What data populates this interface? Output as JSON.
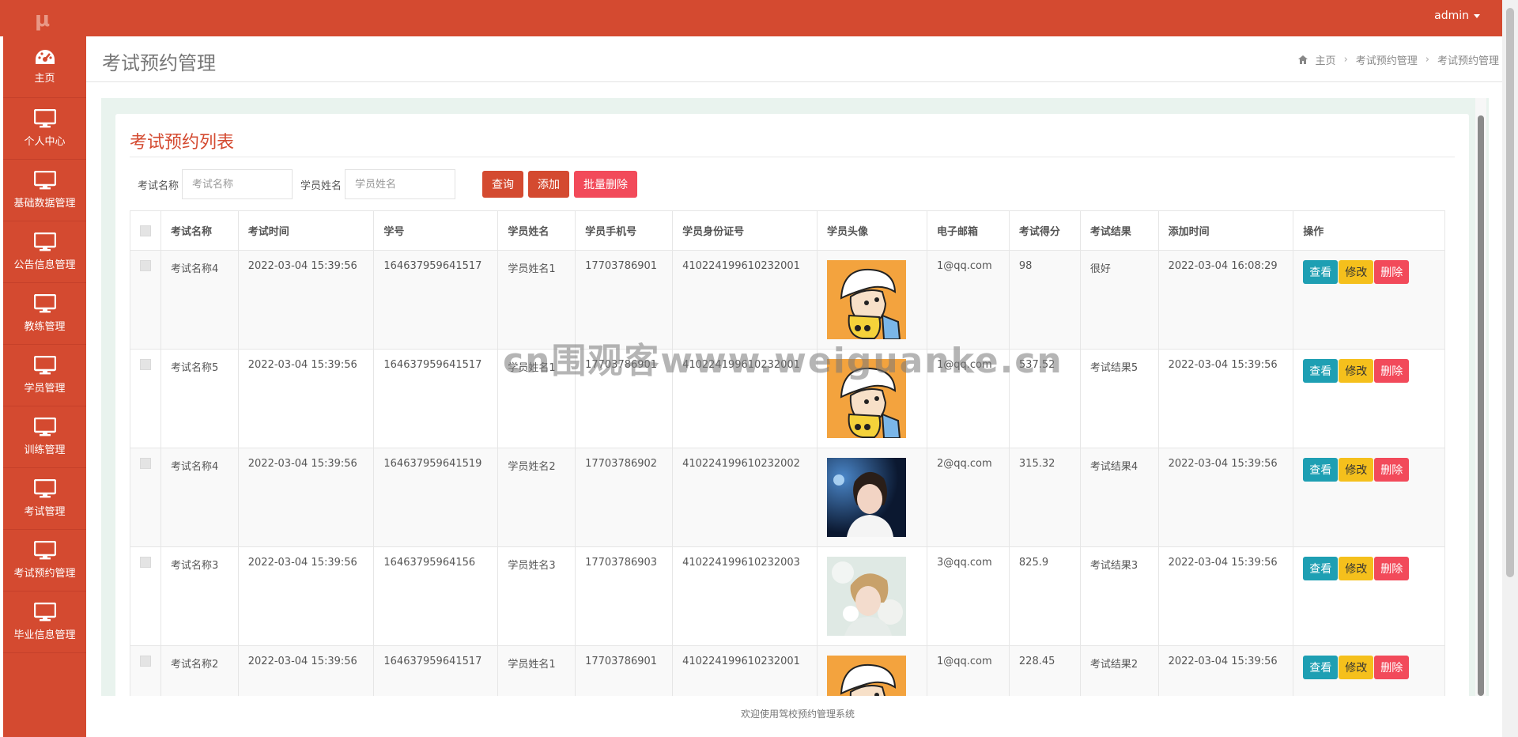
{
  "app": {
    "logo": "μ",
    "user": "admin"
  },
  "sidebar": {
    "items": [
      {
        "label": "主页",
        "icon": "dashboard-icon"
      },
      {
        "label": "个人中心",
        "icon": "monitor-icon"
      },
      {
        "label": "基础数据管理",
        "icon": "monitor-icon"
      },
      {
        "label": "公告信息管理",
        "icon": "monitor-icon"
      },
      {
        "label": "教练管理",
        "icon": "monitor-icon"
      },
      {
        "label": "学员管理",
        "icon": "monitor-icon"
      },
      {
        "label": "训练管理",
        "icon": "monitor-icon"
      },
      {
        "label": "考试管理",
        "icon": "monitor-icon"
      },
      {
        "label": "考试预约管理",
        "icon": "monitor-icon"
      },
      {
        "label": "毕业信息管理",
        "icon": "monitor-icon"
      }
    ]
  },
  "header": {
    "title": "考试预约管理",
    "breadcrumb": [
      "主页",
      "考试预约管理",
      "考试预约管理"
    ]
  },
  "panel": {
    "title": "考试预约列表",
    "filters": [
      {
        "label": "考试名称",
        "placeholder": "考试名称"
      },
      {
        "label": "学员姓名",
        "placeholder": "学员姓名"
      }
    ],
    "buttons": {
      "query": "查询",
      "add": "添加",
      "batch_delete": "批量删除"
    }
  },
  "table": {
    "headers": [
      "考试名称",
      "考试时间",
      "学号",
      "学员姓名",
      "学员手机号",
      "学员身份证号",
      "学员头像",
      "电子邮箱",
      "考试得分",
      "考试结果",
      "添加时间",
      "操作"
    ],
    "rows": [
      [
        "考试名称4",
        "2022-03-04 15:39:56",
        "164637959641517",
        "学员姓名1",
        "17703786901",
        "410224199610232001",
        "cartoon",
        "1@qq.com",
        "98",
        "很好",
        "2022-03-04 16:08:29"
      ],
      [
        "考试名称5",
        "2022-03-04 15:39:56",
        "164637959641517",
        "学员姓名1",
        "17703786901",
        "410224199610232001",
        "cartoon",
        "1@qq.com",
        "537.52",
        "考试结果5",
        "2022-03-04 15:39:56"
      ],
      [
        "考试名称4",
        "2022-03-04 15:39:56",
        "164637959641519",
        "学员姓名2",
        "17703786902",
        "410224199610232002",
        "photo-dark",
        "2@qq.com",
        "315.32",
        "考试结果4",
        "2022-03-04 15:39:56"
      ],
      [
        "考试名称3",
        "2022-03-04 15:39:56",
        "16463795964156",
        "学员姓名3",
        "17703786903",
        "410224199610232003",
        "photo-light",
        "3@qq.com",
        "825.9",
        "考试结果3",
        "2022-03-04 15:39:56"
      ],
      [
        "考试名称2",
        "2022-03-04 15:39:56",
        "164637959641517",
        "学员姓名1",
        "17703786901",
        "410224199610232001",
        "cartoon",
        "1@qq.com",
        "228.45",
        "考试结果2",
        "2022-03-04 15:39:56"
      ]
    ],
    "actions": {
      "view": "查看",
      "edit": "修改",
      "delete": "删除"
    }
  },
  "footer": "欢迎使用驾校预约管理系统",
  "watermark": "cn围观客www.weiguanke.cn",
  "colors": {
    "brand": "#d44a30",
    "view": "#1e9fb3",
    "edit": "#f5c01c",
    "delete": "#f24a5a"
  }
}
